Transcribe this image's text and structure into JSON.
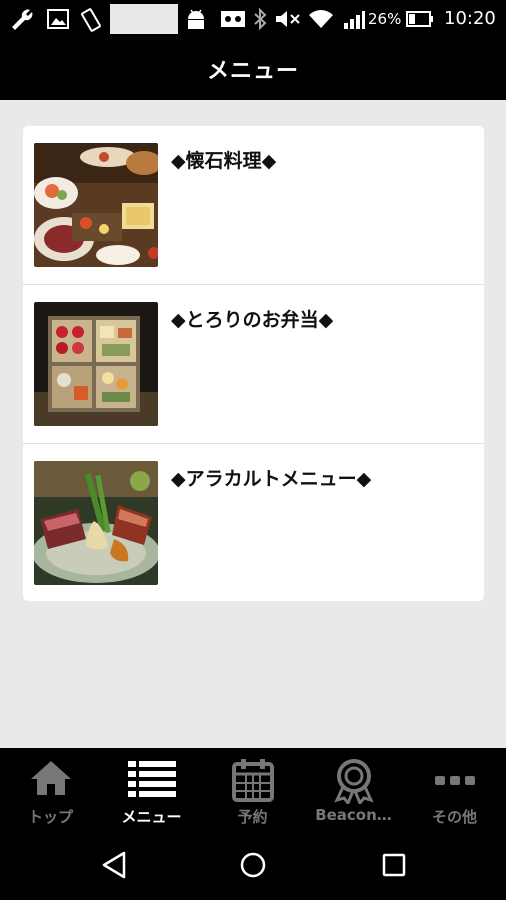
{
  "status_bar": {
    "battery_percent": "26%",
    "time": "10:20",
    "icons": [
      "wrench-icon",
      "image-icon",
      "rotate-icon",
      "android-icon",
      "voicemail-icon",
      "bluetooth-icon",
      "mute-icon",
      "wifi-icon",
      "signal-icon",
      "battery-icon"
    ]
  },
  "header": {
    "title": "メニュー"
  },
  "menu": {
    "items": [
      {
        "label": "◆懐石料理◆",
        "thumb": "kaiseki-photo"
      },
      {
        "label": "◆とろりのお弁当◆",
        "thumb": "bento-photo"
      },
      {
        "label": "◆アラカルトメニュー◆",
        "thumb": "alacarte-photo"
      }
    ]
  },
  "tabs": [
    {
      "label": "トップ",
      "icon": "home-icon",
      "active": false
    },
    {
      "label": "メニュー",
      "icon": "list-icon",
      "active": true
    },
    {
      "label": "予約",
      "icon": "calendar-icon",
      "active": false
    },
    {
      "label": "Beacon…",
      "icon": "award-icon",
      "active": false
    },
    {
      "label": "その他",
      "icon": "more-icon",
      "active": false
    }
  ],
  "nav": {
    "icons": [
      "back-icon",
      "home-circle-icon",
      "recents-icon"
    ]
  },
  "colors": {
    "bar": "#000000",
    "background": "#e9e9e9",
    "card": "#ffffff",
    "inactive_tab": "#777777",
    "active_tab": "#ffffff"
  }
}
